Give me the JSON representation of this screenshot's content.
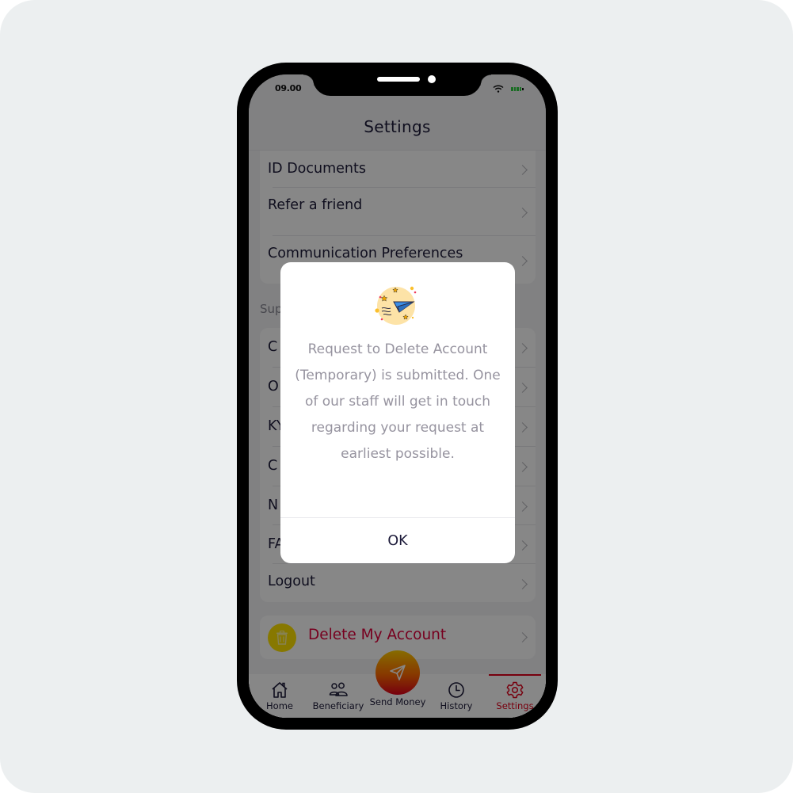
{
  "status_bar": {
    "time": "09.00",
    "icons": [
      "wifi-icon",
      "battery-icon"
    ],
    "battery_color": "#2ecc40"
  },
  "header": {
    "title": "Settings"
  },
  "account_section": {
    "items": [
      {
        "label": "ID Documents",
        "icon": "chevron-right-icon"
      },
      {
        "label": "Refer a friend",
        "icon": "chevron-right-icon"
      },
      {
        "label": "Communication Preferences",
        "icon": "chevron-right-icon"
      }
    ]
  },
  "support_section": {
    "label_visible": "Sup",
    "items": [
      {
        "label_visible": "C"
      },
      {
        "label_visible": "O"
      },
      {
        "label_visible": "KY"
      },
      {
        "label_visible": "C"
      },
      {
        "label_visible": "N"
      },
      {
        "label_visible": "FA"
      },
      {
        "label": "Logout"
      }
    ]
  },
  "delete_account": {
    "label": "Delete My Account",
    "icon": "trash-icon",
    "label_color": "#e0003c",
    "icon_bg": "#ffe200"
  },
  "tabbar": {
    "tabs": [
      {
        "label": "Home",
        "icon": "home-icon",
        "active": false
      },
      {
        "label": "Beneficiary",
        "icon": "users-icon",
        "active": false
      },
      {
        "label": "Send Money",
        "icon": "send-icon",
        "active": false
      },
      {
        "label": "History",
        "icon": "clock-icon",
        "active": false
      },
      {
        "label": "Settings",
        "icon": "gear-icon",
        "active": true
      }
    ],
    "accent": "#e0001b"
  },
  "dialog": {
    "illustration": "paper-plane-icon",
    "message": "Request to Delete Account (Temporary) is submitted. One of our staff will get in touch regarding your request at earliest possible.",
    "ok_label": "OK"
  }
}
